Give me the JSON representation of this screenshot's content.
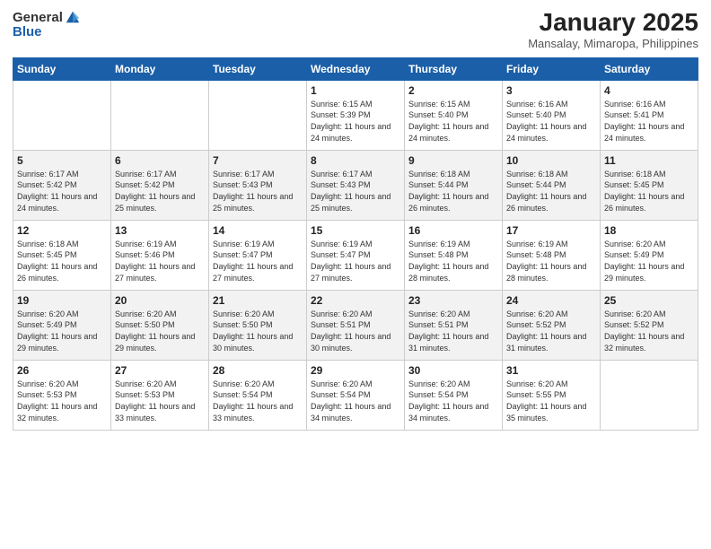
{
  "logo": {
    "general": "General",
    "blue": "Blue"
  },
  "title": "January 2025",
  "subtitle": "Mansalay, Mimaropa, Philippines",
  "days_of_week": [
    "Sunday",
    "Monday",
    "Tuesday",
    "Wednesday",
    "Thursday",
    "Friday",
    "Saturday"
  ],
  "weeks": [
    [
      {
        "day": "",
        "info": ""
      },
      {
        "day": "",
        "info": ""
      },
      {
        "day": "",
        "info": ""
      },
      {
        "day": "1",
        "info": "Sunrise: 6:15 AM\nSunset: 5:39 PM\nDaylight: 11 hours and 24 minutes."
      },
      {
        "day": "2",
        "info": "Sunrise: 6:15 AM\nSunset: 5:40 PM\nDaylight: 11 hours and 24 minutes."
      },
      {
        "day": "3",
        "info": "Sunrise: 6:16 AM\nSunset: 5:40 PM\nDaylight: 11 hours and 24 minutes."
      },
      {
        "day": "4",
        "info": "Sunrise: 6:16 AM\nSunset: 5:41 PM\nDaylight: 11 hours and 24 minutes."
      }
    ],
    [
      {
        "day": "5",
        "info": "Sunrise: 6:17 AM\nSunset: 5:42 PM\nDaylight: 11 hours and 24 minutes."
      },
      {
        "day": "6",
        "info": "Sunrise: 6:17 AM\nSunset: 5:42 PM\nDaylight: 11 hours and 25 minutes."
      },
      {
        "day": "7",
        "info": "Sunrise: 6:17 AM\nSunset: 5:43 PM\nDaylight: 11 hours and 25 minutes."
      },
      {
        "day": "8",
        "info": "Sunrise: 6:17 AM\nSunset: 5:43 PM\nDaylight: 11 hours and 25 minutes."
      },
      {
        "day": "9",
        "info": "Sunrise: 6:18 AM\nSunset: 5:44 PM\nDaylight: 11 hours and 26 minutes."
      },
      {
        "day": "10",
        "info": "Sunrise: 6:18 AM\nSunset: 5:44 PM\nDaylight: 11 hours and 26 minutes."
      },
      {
        "day": "11",
        "info": "Sunrise: 6:18 AM\nSunset: 5:45 PM\nDaylight: 11 hours and 26 minutes."
      }
    ],
    [
      {
        "day": "12",
        "info": "Sunrise: 6:18 AM\nSunset: 5:45 PM\nDaylight: 11 hours and 26 minutes."
      },
      {
        "day": "13",
        "info": "Sunrise: 6:19 AM\nSunset: 5:46 PM\nDaylight: 11 hours and 27 minutes."
      },
      {
        "day": "14",
        "info": "Sunrise: 6:19 AM\nSunset: 5:47 PM\nDaylight: 11 hours and 27 minutes."
      },
      {
        "day": "15",
        "info": "Sunrise: 6:19 AM\nSunset: 5:47 PM\nDaylight: 11 hours and 27 minutes."
      },
      {
        "day": "16",
        "info": "Sunrise: 6:19 AM\nSunset: 5:48 PM\nDaylight: 11 hours and 28 minutes."
      },
      {
        "day": "17",
        "info": "Sunrise: 6:19 AM\nSunset: 5:48 PM\nDaylight: 11 hours and 28 minutes."
      },
      {
        "day": "18",
        "info": "Sunrise: 6:20 AM\nSunset: 5:49 PM\nDaylight: 11 hours and 29 minutes."
      }
    ],
    [
      {
        "day": "19",
        "info": "Sunrise: 6:20 AM\nSunset: 5:49 PM\nDaylight: 11 hours and 29 minutes."
      },
      {
        "day": "20",
        "info": "Sunrise: 6:20 AM\nSunset: 5:50 PM\nDaylight: 11 hours and 29 minutes."
      },
      {
        "day": "21",
        "info": "Sunrise: 6:20 AM\nSunset: 5:50 PM\nDaylight: 11 hours and 30 minutes."
      },
      {
        "day": "22",
        "info": "Sunrise: 6:20 AM\nSunset: 5:51 PM\nDaylight: 11 hours and 30 minutes."
      },
      {
        "day": "23",
        "info": "Sunrise: 6:20 AM\nSunset: 5:51 PM\nDaylight: 11 hours and 31 minutes."
      },
      {
        "day": "24",
        "info": "Sunrise: 6:20 AM\nSunset: 5:52 PM\nDaylight: 11 hours and 31 minutes."
      },
      {
        "day": "25",
        "info": "Sunrise: 6:20 AM\nSunset: 5:52 PM\nDaylight: 11 hours and 32 minutes."
      }
    ],
    [
      {
        "day": "26",
        "info": "Sunrise: 6:20 AM\nSunset: 5:53 PM\nDaylight: 11 hours and 32 minutes."
      },
      {
        "day": "27",
        "info": "Sunrise: 6:20 AM\nSunset: 5:53 PM\nDaylight: 11 hours and 33 minutes."
      },
      {
        "day": "28",
        "info": "Sunrise: 6:20 AM\nSunset: 5:54 PM\nDaylight: 11 hours and 33 minutes."
      },
      {
        "day": "29",
        "info": "Sunrise: 6:20 AM\nSunset: 5:54 PM\nDaylight: 11 hours and 34 minutes."
      },
      {
        "day": "30",
        "info": "Sunrise: 6:20 AM\nSunset: 5:54 PM\nDaylight: 11 hours and 34 minutes."
      },
      {
        "day": "31",
        "info": "Sunrise: 6:20 AM\nSunset: 5:55 PM\nDaylight: 11 hours and 35 minutes."
      },
      {
        "day": "",
        "info": ""
      }
    ]
  ]
}
